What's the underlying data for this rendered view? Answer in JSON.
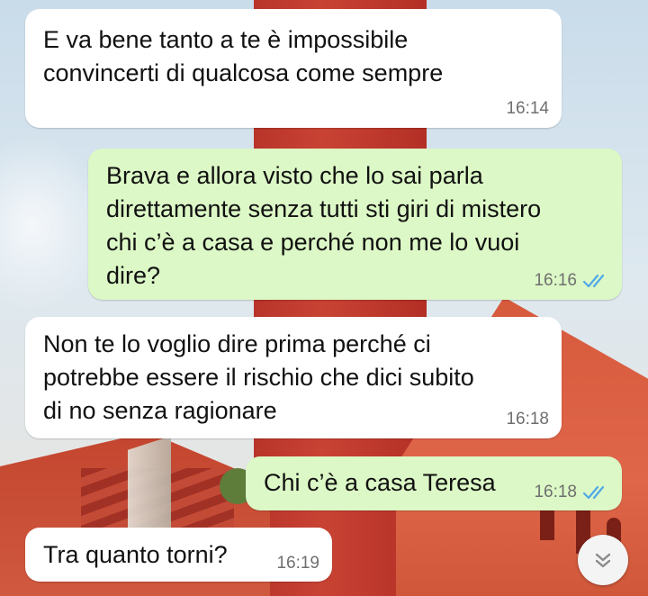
{
  "chat": {
    "messages": [
      {
        "direction": "in",
        "text": "E va bene tanto a te è impossibile\nconvincerti di qualcosa come sempre",
        "time": "16:14"
      },
      {
        "direction": "out",
        "text": "Brava e allora visto che lo sai parla\ndirettamente senza tutti sti giri di mistero\nchi c’è a casa e perché non me lo vuoi\ndire?",
        "time": "16:16",
        "status": "read"
      },
      {
        "direction": "in",
        "text": "Non te lo voglio dire prima perché ci\npotrebbe essere il rischio che dici subito\ndi no senza ragionare",
        "time": "16:18"
      },
      {
        "direction": "out",
        "text": "Chi c’è a casa Teresa",
        "time": "16:18",
        "status": "read"
      },
      {
        "direction": "in",
        "text": "Tra quanto torni?",
        "time": "16:19"
      }
    ]
  },
  "colors": {
    "incoming_bubble": "#ffffff",
    "outgoing_bubble": "#dcf8c6",
    "read_ticks": "#4fa9e8",
    "timestamp": "#6f6f6f"
  },
  "icons": {
    "read_receipt": "double-check-icon",
    "scroll_down": "double-chevron-down-icon"
  }
}
